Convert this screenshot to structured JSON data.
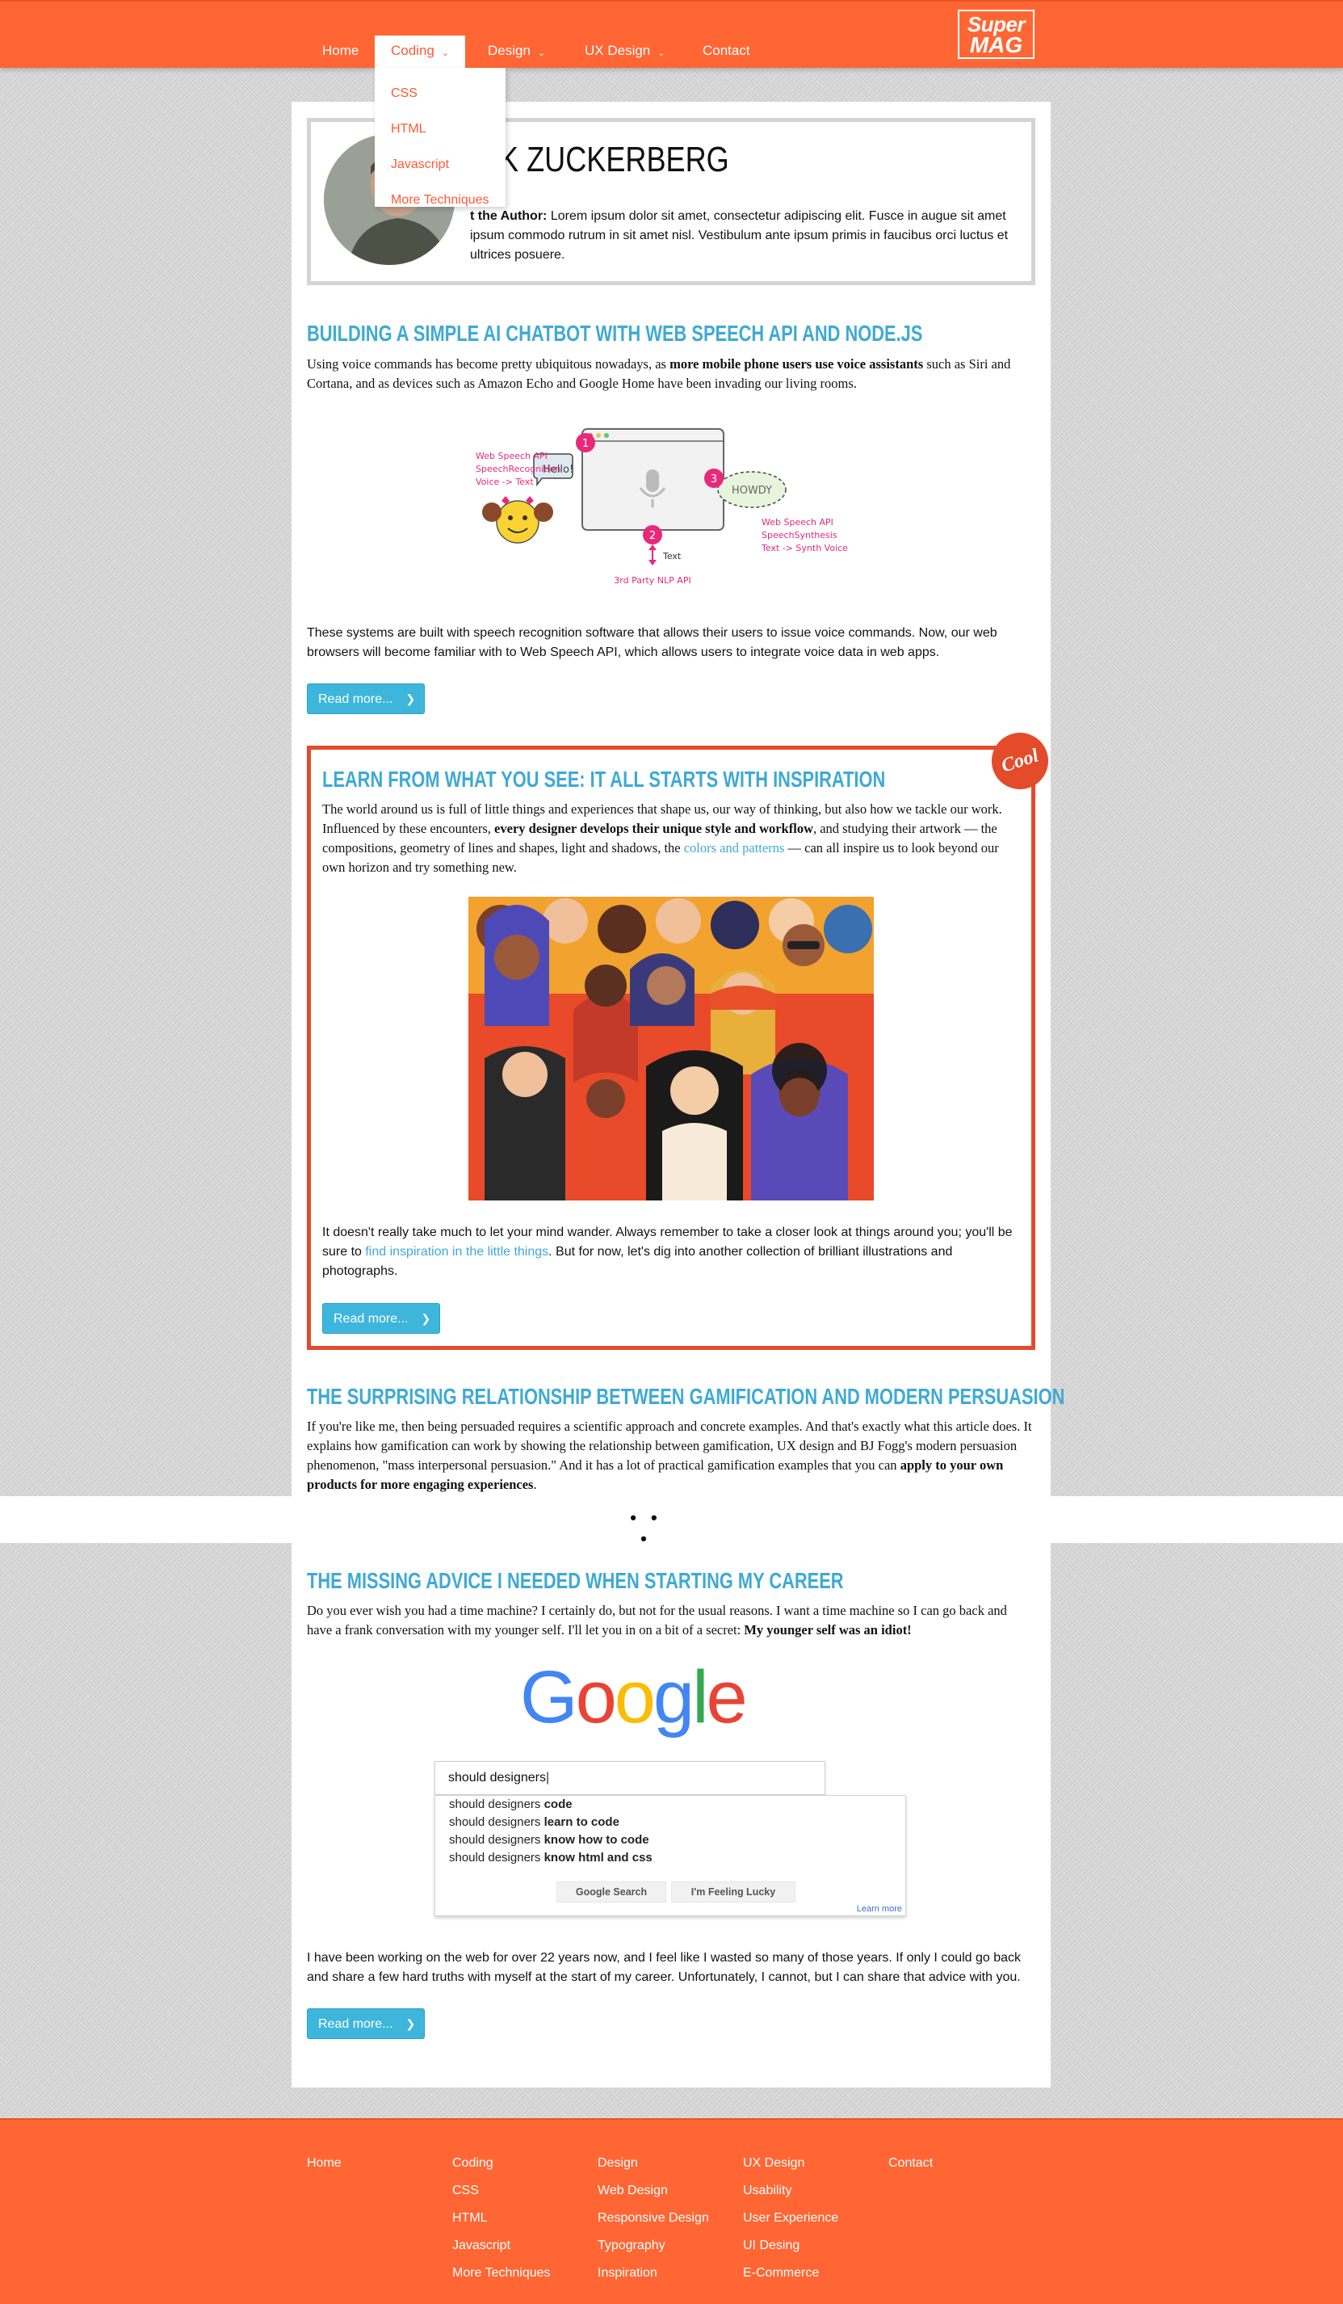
{
  "header": {
    "nav": [
      {
        "label": "Home",
        "chevron": false
      },
      {
        "label": "Coding",
        "chevron": true
      },
      {
        "label": "Design",
        "chevron": true
      },
      {
        "label": "UX Design",
        "chevron": true
      },
      {
        "label": "Contact",
        "chevron": false
      }
    ],
    "logo": {
      "line1": "Super",
      "line2": "MAG"
    },
    "dropdown": [
      "CSS",
      "HTML",
      "Javascript",
      "More Techniques"
    ]
  },
  "author": {
    "name": "RK ZUCKERBERG",
    "about_label": "t the Author:",
    "about_text": "Lorem ipsum dolor sit amet, consectetur adipiscing elit. Fusce in augue sit amet ipsum commodo rutrum in sit amet nisl. Vestibulum ante ipsum primis in faucibus orci luctus et ultrices posuere."
  },
  "posts": [
    {
      "title": "Building a Simple AI Chatbot With Web Speech API and Node.js",
      "intro_a": "Using voice commands has become pretty ubiquitous nowadays, as ",
      "intro_bold": "more mobile phone users use voice assistants",
      "intro_b": " such as Siri and Cortana, and as devices such as Amazon Echo and Google Home have been invading our living rooms.",
      "diagram": {
        "left_labels": [
          "Web Speech API",
          "SpeechRecognition",
          "Voice -> Text"
        ],
        "right_labels": [
          "Web Speech API",
          "SpeechSynthesis",
          "Text -> Synth Voice"
        ],
        "bubble_left": "Hello!",
        "bubble_right": "HOWDY",
        "bottom_text": "Text",
        "bottom_label": "3rd Party NLP API",
        "steps": [
          "1",
          "2",
          "3"
        ]
      },
      "body": "These systems are built with speech recognition software that allows their users to issue voice commands. Now, our web browsers will become familiar with to Web Speech API, which allows users to integrate voice data in web apps.",
      "button": "Read more..."
    },
    {
      "title": "Learn From What You See: It All Starts With Inspiration",
      "badge": "Cool",
      "intro_a": "The world around us is full of little things and experiences that shape us, our way of thinking, but also how we tackle our work. Influenced by these encounters, ",
      "intro_bold": "every designer develops their unique style and workflow",
      "intro_b": ", and studying their artwork — the compositions, geometry of lines and shapes, light and shadows, the ",
      "intro_link": "colors and patterns",
      "intro_c": " — can all inspire us to look beyond our own horizon and try something new.",
      "body_a": "It doesn't really take much to let your mind wander. Always remember to take a closer look at things around you; you'll be sure to ",
      "body_link": "find inspiration in the little things",
      "body_b": ". But for now, let's dig into another collection of brilliant illustrations and photographs.",
      "button": "Read more..."
    },
    {
      "title": "The Surprising Relationship Between Gamification and Modern Persuasion",
      "intro_a": "If you're like me, then being persuaded requires a scientific approach and concrete examples. And that's exactly what this article does. It explains how gamification can work by showing the relationship between gamification, UX design and BJ Fogg's modern persuasion phenomenon, \"mass interpersonal persuasion.\" And it has a lot of practical gamification examples that you can ",
      "intro_bold": "apply to your own products for more engaging experiences",
      "intro_b": "."
    },
    {
      "title": "The Missing Advice I Needed When Starting My Career",
      "intro_a": "Do you ever wish you had a time machine? I certainly do, but not for the usual reasons. I want a time machine so I can go back and have a frank conversation with my younger self. I'll let you in on a bit of a secret: ",
      "intro_bold": "My younger self was an idiot!",
      "google": {
        "logo": [
          "G",
          "o",
          "o",
          "g",
          "l",
          "e"
        ],
        "query": "should designers",
        "suggestions": [
          {
            "prefix": "should designers ",
            "bold": "code"
          },
          {
            "prefix": "should designers ",
            "bold": "learn to code"
          },
          {
            "prefix": "should designers ",
            "bold": "know how to code"
          },
          {
            "prefix": "should designers ",
            "bold": "know html and css"
          }
        ],
        "btn_search": "Google Search",
        "btn_lucky": "I'm Feeling Lucky",
        "learn_more": "Learn more"
      },
      "body": "I have been working on the web for over 22 years now, and I feel like I wasted so many of those years. If only I could go back and share a few hard truths with myself at the start of my career. Unfortunately, I cannot, but I can share that advice with you.",
      "button": "Read more..."
    }
  ],
  "gap_marker": "• • •",
  "footer": {
    "columns": [
      [
        "Home"
      ],
      [
        "Coding",
        "CSS",
        "HTML",
        "Javascript",
        "More Techniques"
      ],
      [
        "Design",
        "Web Design",
        "Responsive Design",
        "Typography",
        "Inspiration"
      ],
      [
        "UX Design",
        "Usability",
        "User Experience",
        "UI Desing",
        "E-Commerce"
      ],
      [
        "Contact"
      ]
    ]
  },
  "colors": {
    "brand_orange": "#ff6633",
    "title_blue": "#3eaad4",
    "button_blue": "#3eb6dc",
    "featured_border": "#e34b2a"
  }
}
